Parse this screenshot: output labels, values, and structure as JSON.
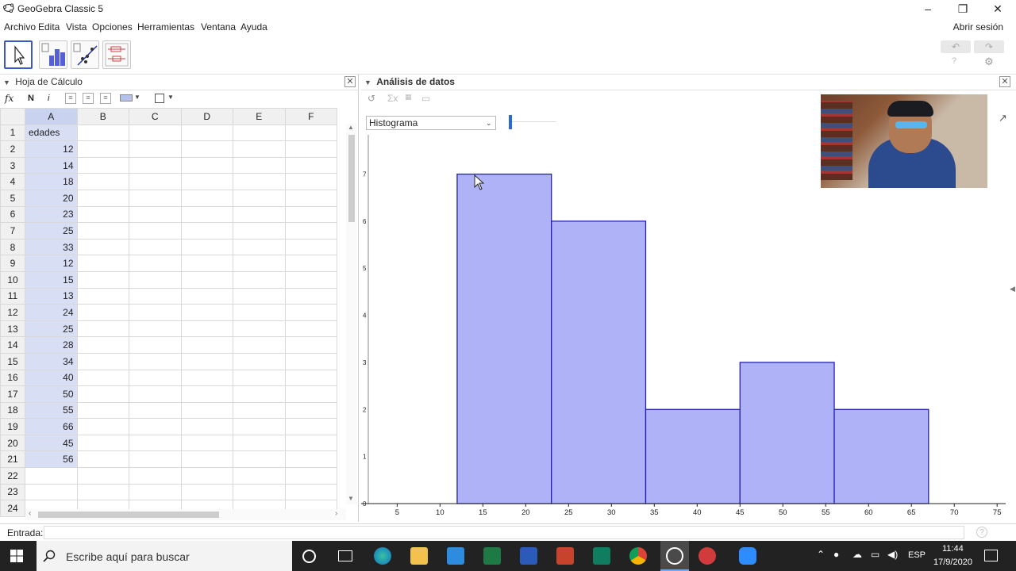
{
  "window": {
    "title": "GeoGebra Classic 5",
    "min": "–",
    "max": "❐",
    "close": "✕"
  },
  "menu": [
    "Archivo",
    "Edita",
    "Vista",
    "Opciones",
    "Herramientas",
    "Ventana",
    "Ayuda"
  ],
  "login": "Abrir sesión",
  "spreadsheet": {
    "title": "Hoja de Cálculo",
    "fx": "fx",
    "bold": "N",
    "italic": "i",
    "columns": [
      "A",
      "B",
      "C",
      "D",
      "E",
      "F"
    ],
    "rows": [
      {
        "n": "1",
        "a": "edades"
      },
      {
        "n": "2",
        "a": "12"
      },
      {
        "n": "3",
        "a": "14"
      },
      {
        "n": "4",
        "a": "18"
      },
      {
        "n": "5",
        "a": "20"
      },
      {
        "n": "6",
        "a": "23"
      },
      {
        "n": "7",
        "a": "25"
      },
      {
        "n": "8",
        "a": "33"
      },
      {
        "n": "9",
        "a": "12"
      },
      {
        "n": "10",
        "a": "15"
      },
      {
        "n": "11",
        "a": "13"
      },
      {
        "n": "12",
        "a": "24"
      },
      {
        "n": "13",
        "a": "25"
      },
      {
        "n": "14",
        "a": "28"
      },
      {
        "n": "15",
        "a": "34"
      },
      {
        "n": "16",
        "a": "40"
      },
      {
        "n": "17",
        "a": "50"
      },
      {
        "n": "18",
        "a": "55"
      },
      {
        "n": "19",
        "a": "66"
      },
      {
        "n": "20",
        "a": "45"
      },
      {
        "n": "21",
        "a": "56"
      },
      {
        "n": "22",
        "a": ""
      },
      {
        "n": "23",
        "a": ""
      },
      {
        "n": "24",
        "a": ""
      }
    ]
  },
  "analysis": {
    "title": "Análisis de datos",
    "plot_type": "Histograma"
  },
  "chart_data": {
    "type": "bar",
    "title": "",
    "xlabel": "",
    "ylabel": "",
    "bins": [
      {
        "from": 12,
        "to": 23,
        "count": 7
      },
      {
        "from": 23,
        "to": 34,
        "count": 6
      },
      {
        "from": 34,
        "to": 45,
        "count": 2
      },
      {
        "from": 45,
        "to": 56,
        "count": 3
      },
      {
        "from": 56,
        "to": 67,
        "count": 2
      }
    ],
    "xlim": [
      0.8,
      76
    ],
    "ylim": [
      0,
      7.7
    ],
    "xticks": [
      "5",
      "10",
      "15",
      "20",
      "25",
      "30",
      "35",
      "40",
      "45",
      "50",
      "55",
      "60",
      "65",
      "70",
      "75"
    ],
    "yticks": [
      "0",
      "1",
      "2",
      "3",
      "4",
      "5",
      "6",
      "7"
    ],
    "bar_fill": "#b0b2f7",
    "bar_stroke": "#2222b0",
    "grid": false
  },
  "input": {
    "label": "Entrada:"
  },
  "taskbar": {
    "search": "Escribe aquí para buscar",
    "lang": "ESP",
    "time": "11:44",
    "date": "17/9/2020"
  }
}
